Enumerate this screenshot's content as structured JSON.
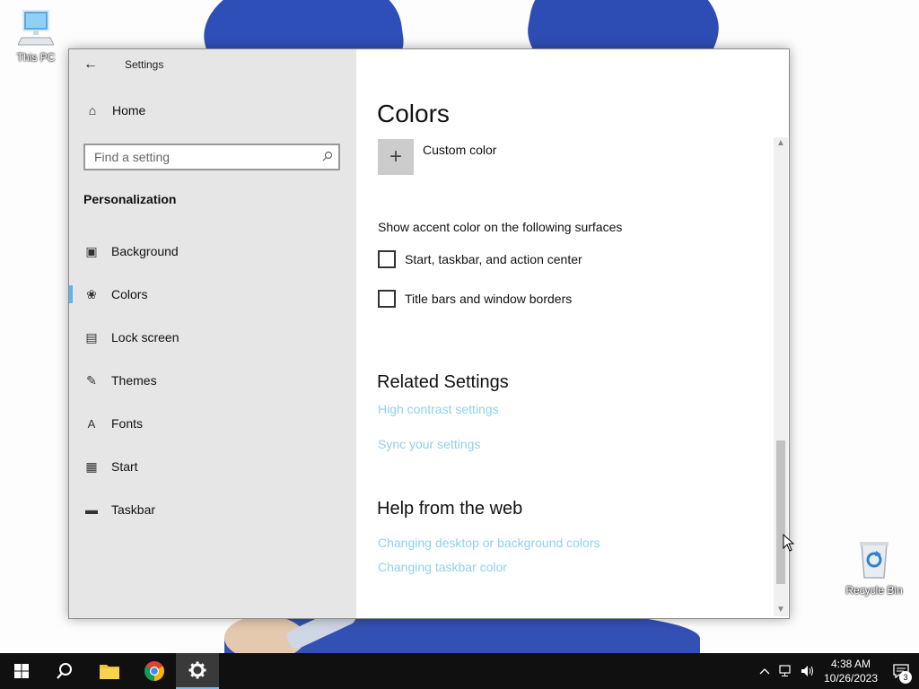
{
  "desktop": {
    "icons": [
      {
        "label": "This PC"
      },
      {
        "label": "Recycle Bin"
      }
    ]
  },
  "window": {
    "title": "Settings",
    "controls": {
      "minimize": "minimize-icon",
      "maximize": "maximize-icon",
      "close": "close-icon"
    }
  },
  "nav": {
    "home_label": "Home",
    "search_placeholder": "Find a setting",
    "section_label": "Personalization",
    "items": [
      {
        "label": "Background",
        "icon": "picture-icon"
      },
      {
        "label": "Colors",
        "icon": "palette-icon",
        "selected": true
      },
      {
        "label": "Lock screen",
        "icon": "lock-screen-icon"
      },
      {
        "label": "Themes",
        "icon": "themes-icon"
      },
      {
        "label": "Fonts",
        "icon": "fonts-icon"
      },
      {
        "label": "Start",
        "icon": "start-icon"
      },
      {
        "label": "Taskbar",
        "icon": "taskbar-icon"
      }
    ]
  },
  "content": {
    "title": "Colors",
    "custom_color_label": "Custom color",
    "surfaces_label": "Show accent color on the following surfaces",
    "checkboxes": [
      {
        "label": "Start, taskbar, and action center",
        "checked": false
      },
      {
        "label": "Title bars and window borders",
        "checked": false
      }
    ],
    "related_heading": "Related Settings",
    "related_links": [
      "High contrast settings",
      "Sync your settings"
    ],
    "help_heading": "Help from the web",
    "help_links": [
      "Changing desktop or background colors",
      "Changing taskbar color"
    ]
  },
  "taskbar": {
    "time": "4:38 AM",
    "date": "10/26/2023",
    "notification_count": "3"
  },
  "colors": {
    "accent": "#5fb3f3",
    "link": "#8fd1ee",
    "nav_bg": "#e6e6e6",
    "taskbar_bg": "#101010"
  }
}
